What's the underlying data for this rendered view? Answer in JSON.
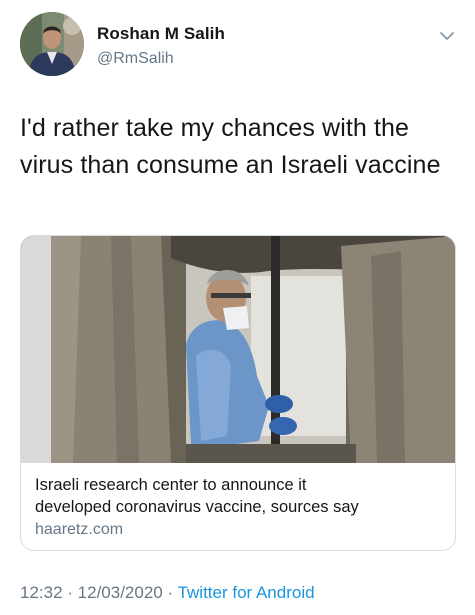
{
  "author": {
    "name": "Roshan M Salih",
    "handle": "@RmSalih"
  },
  "tweet": {
    "text_line1": "I'd rather take my chances with the",
    "text_line2": "virus than consume an Israeli vaccine"
  },
  "card": {
    "title_line1": "Israeli research center to announce it",
    "title_line2": "developed coronavirus vaccine, sources say",
    "domain": "haaretz.com"
  },
  "meta": {
    "time": "12:32",
    "separator1": " · ",
    "date": "12/03/2020",
    "separator2": " · ",
    "source": "Twitter for Android"
  },
  "icons": {
    "more": "chevron-down-icon"
  },
  "colors": {
    "text": "#14171a",
    "secondary": "#657786",
    "link": "#1b95e0"
  }
}
